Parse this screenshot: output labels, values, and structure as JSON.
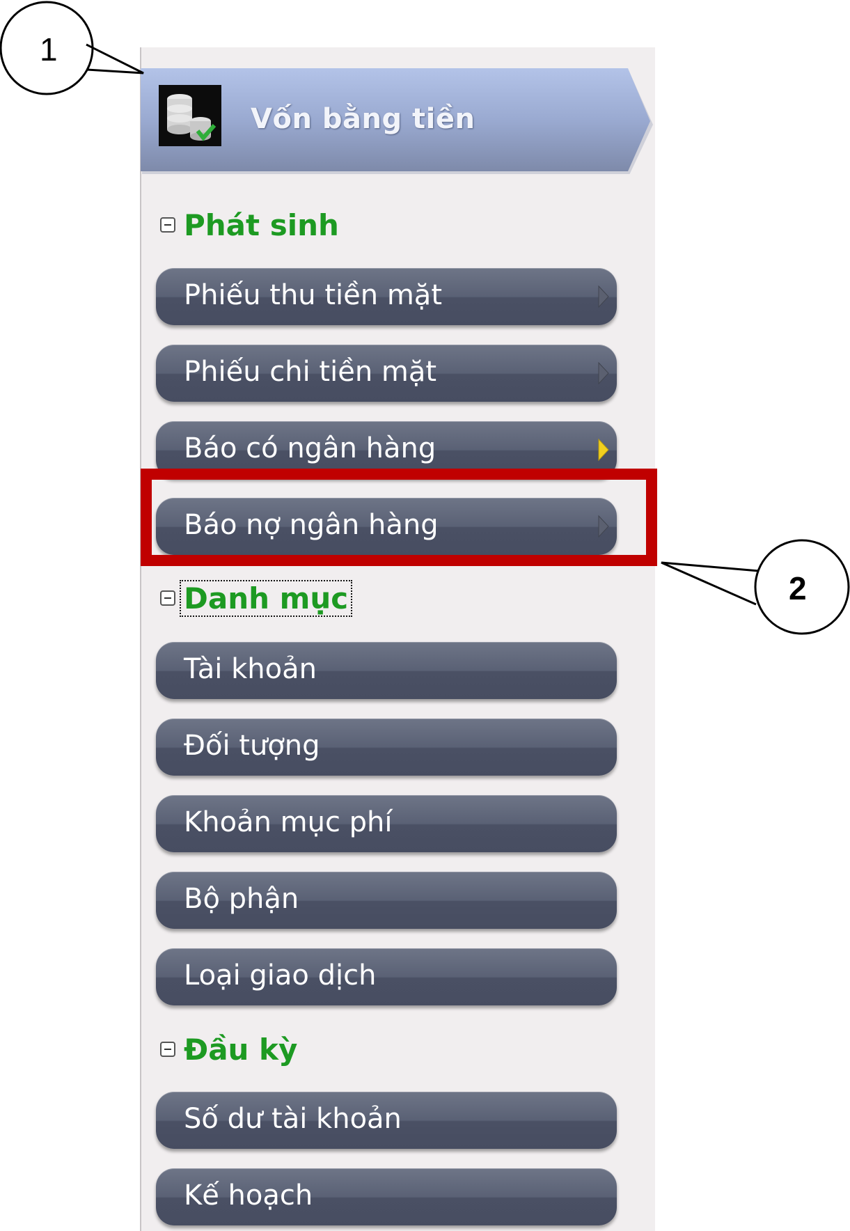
{
  "header": {
    "title": "Vốn bằng tiền",
    "icon": "money-coins-icon"
  },
  "sections": [
    {
      "label": "Phát sinh",
      "items": [
        "Phiếu thu tiền mặt",
        "Phiếu chi tiền mặt",
        "Báo có ngân hàng",
        "Báo nợ ngân hàng"
      ]
    },
    {
      "label": "Danh mục",
      "items": [
        "Tài khoản",
        "Đối tượng",
        "Khoản mục phí",
        "Bộ phận",
        "Loại giao dịch"
      ]
    },
    {
      "label": "Đầu kỳ",
      "items": [
        "Số dư tài khoản",
        "Kế hoạch"
      ]
    }
  ],
  "callouts": [
    "1",
    "2"
  ],
  "colors": {
    "section_label": "#1d9a22",
    "highlight": "#c00000",
    "button": "#5a6175"
  }
}
